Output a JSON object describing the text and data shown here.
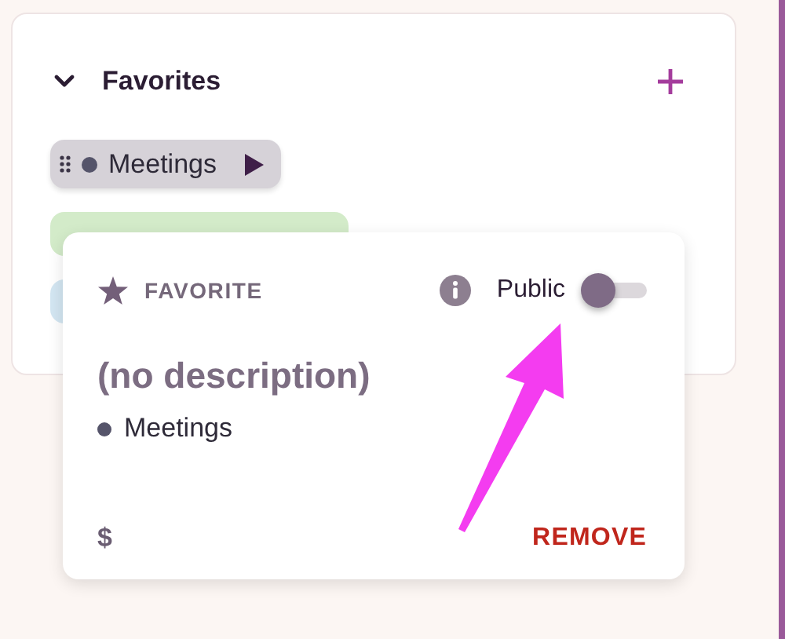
{
  "section": {
    "title": "Favorites",
    "expanded": true
  },
  "favorites": [
    {
      "label": "Meetings",
      "color": "#55546a",
      "selected": true
    },
    {
      "color": "#d3ebc9",
      "selected": false
    },
    {
      "color": "#d3e6f2",
      "selected": false
    }
  ],
  "popover": {
    "type_label": "FAVORITE",
    "public_label": "Public",
    "public": false,
    "description": "(no description)",
    "tag": {
      "label": "Meetings",
      "color": "#55546a"
    },
    "currency": "$",
    "remove": "REMOVE"
  }
}
